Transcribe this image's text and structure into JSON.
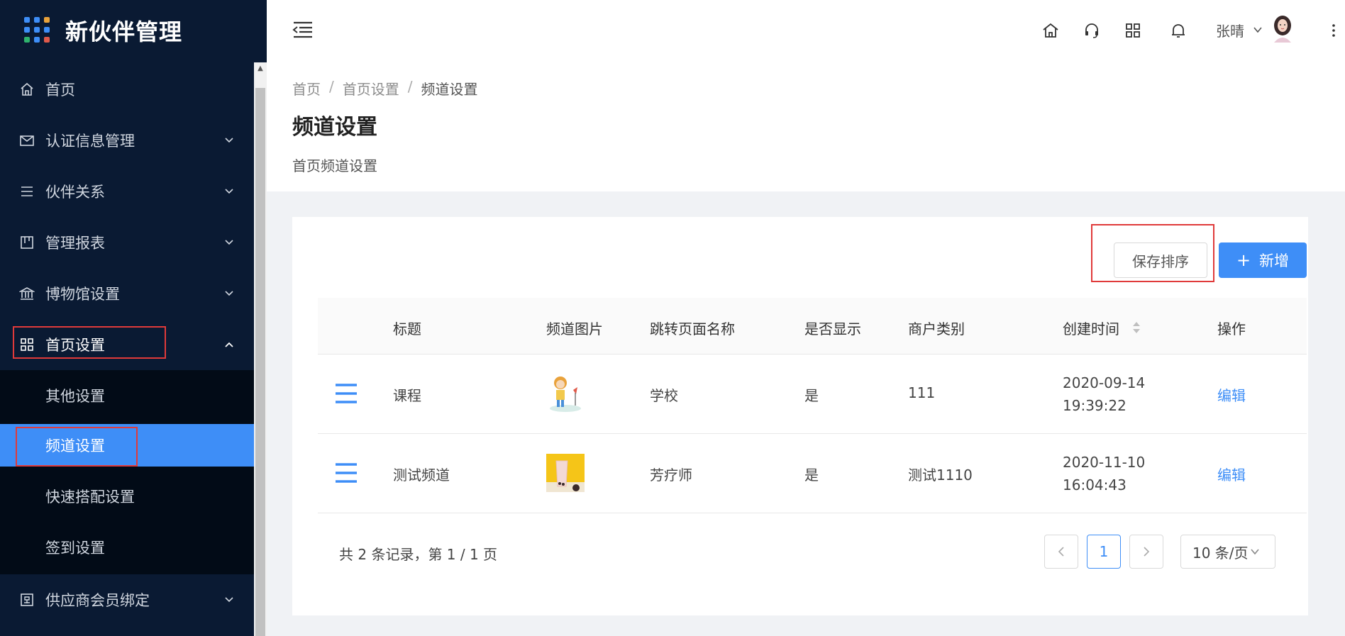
{
  "app": {
    "title": "新伙伴管理"
  },
  "sidebar": {
    "items": [
      {
        "label": "首页",
        "icon": "home-icon"
      },
      {
        "label": "认证信息管理",
        "icon": "mail-icon"
      },
      {
        "label": "伙伴关系",
        "icon": "list-icon"
      },
      {
        "label": "管理报表",
        "icon": "board-icon"
      },
      {
        "label": "博物馆设置",
        "icon": "bank-icon"
      },
      {
        "label": "首页设置",
        "icon": "apps-icon",
        "expanded": true
      },
      {
        "label": "供应商会员绑定",
        "icon": "binding-icon"
      }
    ],
    "submenu": [
      {
        "label": "其他设置"
      },
      {
        "label": "频道设置",
        "active": true
      },
      {
        "label": "快速搭配设置"
      },
      {
        "label": "签到设置"
      }
    ]
  },
  "header": {
    "user_name": "张晴",
    "icons": [
      "home-icon",
      "headset-icon",
      "apps-icon",
      "bell-icon"
    ]
  },
  "breadcrumb": [
    "首页",
    "首页设置",
    "频道设置"
  ],
  "page": {
    "title": "频道设置",
    "description": "首页频道设置"
  },
  "toolbar": {
    "save_sort_label": "保存排序",
    "add_label": "新增"
  },
  "table": {
    "columns": [
      "标题",
      "频道图片",
      "跳转页面名称",
      "是否显示",
      "商户类别",
      "创建时间",
      "操作"
    ],
    "rows": [
      {
        "title": "课程",
        "page_name": "学校",
        "visible": "是",
        "category": "111",
        "date": "2020-09-14",
        "time": "19:39:22",
        "action": "编辑"
      },
      {
        "title": "测试频道",
        "page_name": "芳疗师",
        "visible": "是",
        "category": "测试1110",
        "date": "2020-11-10",
        "time": "16:04:43",
        "action": "编辑"
      }
    ]
  },
  "pagination": {
    "info": "共 2 条记录，第 1 / 1 页",
    "current_page": "1",
    "page_size": "10 条/页"
  },
  "colors": {
    "sidebar_bg": "#0a1a33",
    "submenu_bg": "#020b17",
    "accent": "#3e8ef7",
    "highlight": "#e03a3a"
  }
}
